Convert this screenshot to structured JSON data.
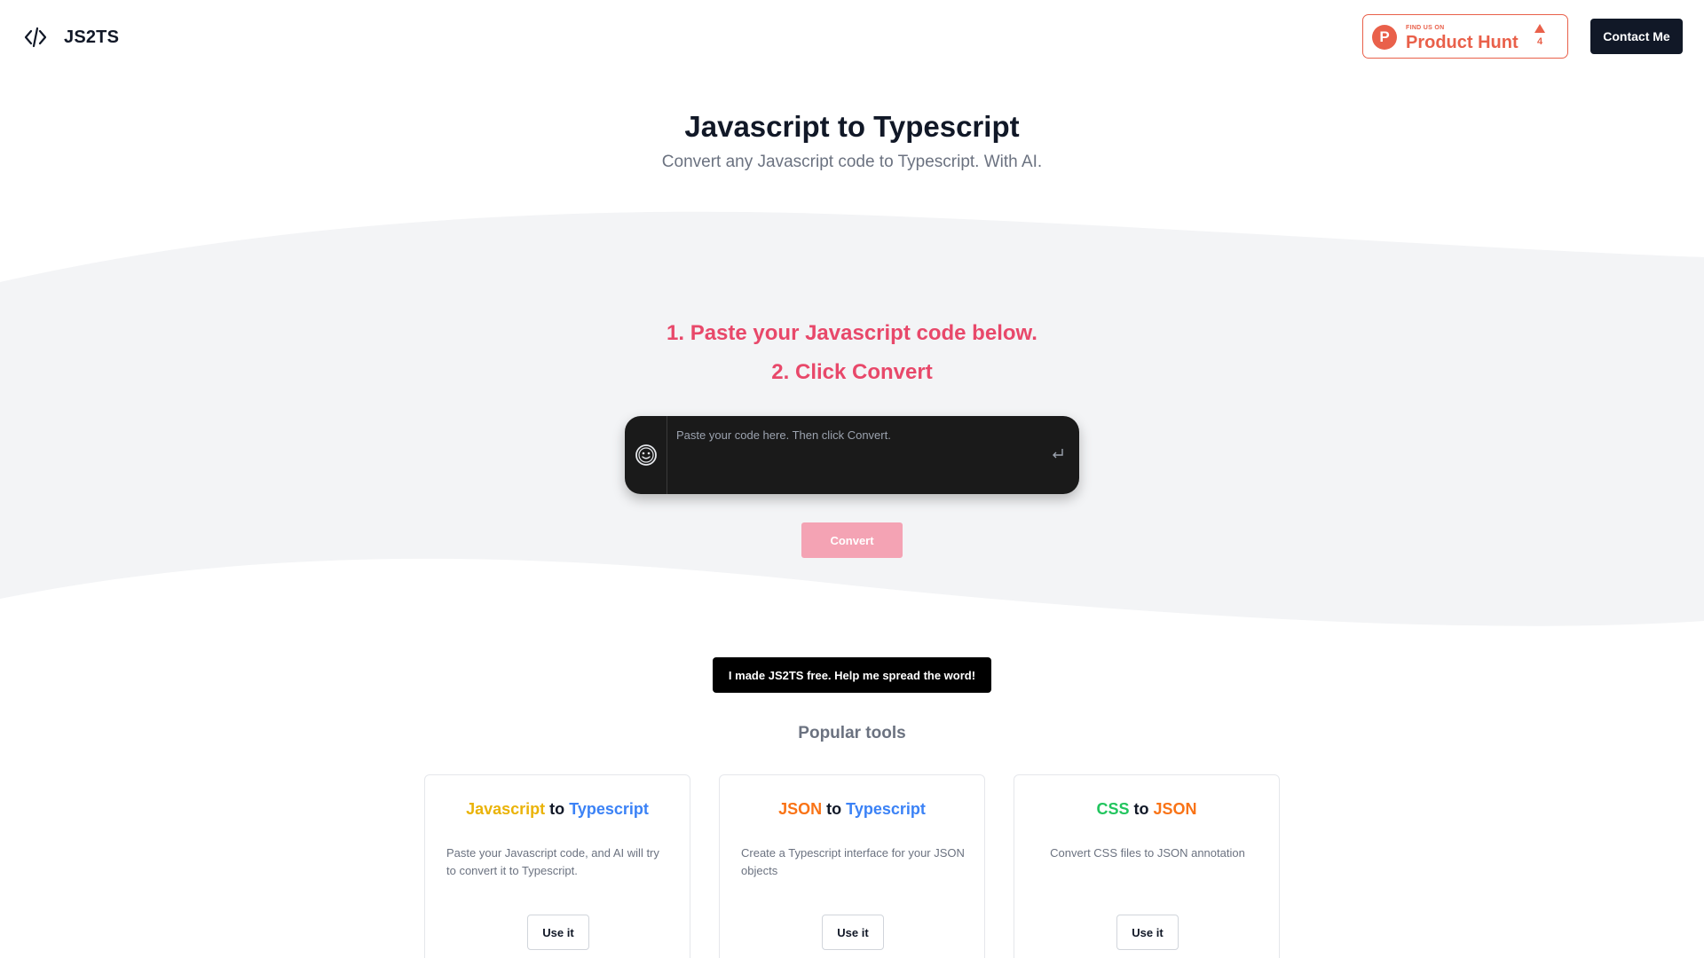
{
  "header": {
    "logo_text": "JS2TS",
    "logo_icon": "code-icon",
    "product_hunt": {
      "small_text": "FIND US ON",
      "name": "Product Hunt",
      "votes": "4",
      "color": "#e9604a"
    },
    "contact_label": "Contact Me"
  },
  "hero": {
    "title": "Javascript to Typescript",
    "subtitle": "Convert any Javascript code to Typescript. With AI."
  },
  "steps": {
    "step1": "1. Paste your Javascript code below.",
    "step2": "2. Click Convert",
    "color": "#e8486a"
  },
  "editor": {
    "placeholder": "Paste your code here. Then click Convert.",
    "value": "",
    "left_icon": "smiley-icon",
    "right_icon": "enter-icon"
  },
  "convert_label": "Convert",
  "spread_label": "I made JS2TS free. Help me spread the word!",
  "popular": {
    "title": "Popular tools",
    "cards": [
      {
        "title_from": "Javascript",
        "title_to_word": "to",
        "title_to": "Typescript",
        "from_color": "#eab308",
        "to_color": "#3b82f6",
        "description": "Paste your Javascript code, and AI will try to convert it to Typescript.",
        "button": "Use it"
      },
      {
        "title_from": "JSON",
        "title_to_word": "to",
        "title_to": "Typescript",
        "from_color": "#f97316",
        "to_color": "#3b82f6",
        "description": "Create a Typescript interface for your JSON objects",
        "button": "Use it"
      },
      {
        "title_from": "CSS",
        "title_to_word": "to",
        "title_to": "JSON",
        "from_color": "#22c55e",
        "to_color": "#f97316",
        "description": "Convert CSS files to JSON annotation",
        "button": "Use it"
      }
    ]
  }
}
